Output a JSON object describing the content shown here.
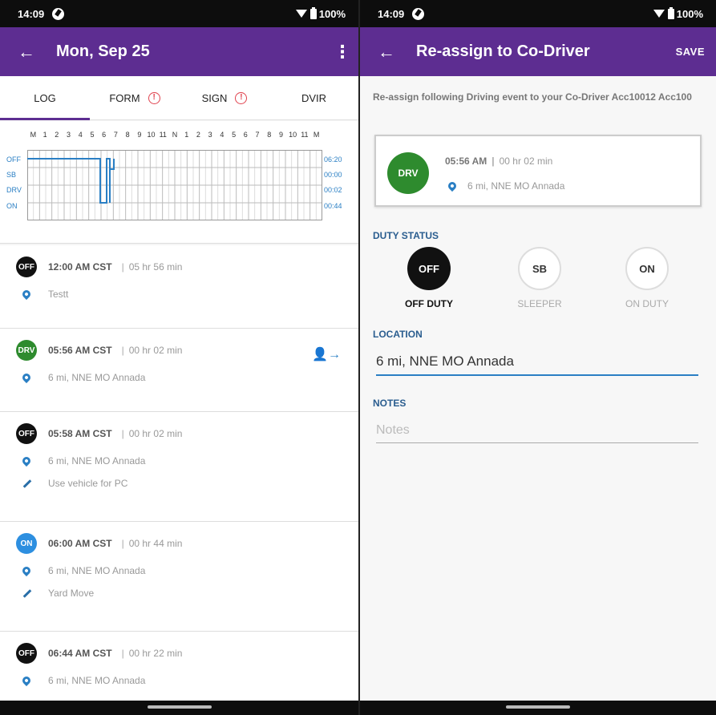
{
  "status_bar": {
    "time": "14:09",
    "battery": "100%"
  },
  "left": {
    "title": "Mon, Sep 25",
    "tabs": [
      {
        "label": "LOG",
        "warning": false
      },
      {
        "label": "FORM",
        "warning": true
      },
      {
        "label": "SIGN",
        "warning": true
      },
      {
        "label": "DVIR",
        "warning": false
      }
    ],
    "graph": {
      "hours": [
        "M",
        "1",
        "2",
        "3",
        "4",
        "5",
        "6",
        "7",
        "8",
        "9",
        "10",
        "11",
        "N",
        "1",
        "2",
        "3",
        "4",
        "5",
        "6",
        "7",
        "8",
        "9",
        "10",
        "11",
        "M"
      ],
      "rows": [
        {
          "label": "OFF",
          "total": "06:20"
        },
        {
          "label": "SB",
          "total": "00:00"
        },
        {
          "label": "DRV",
          "total": "00:02"
        },
        {
          "label": "ON",
          "total": "00:44"
        }
      ]
    },
    "entries": [
      {
        "badge": "OFF",
        "time": "12:00 AM CST",
        "duration": "05 hr 56 min",
        "location": "Testt",
        "note": ""
      },
      {
        "badge": "DRV",
        "time": "05:56 AM CST",
        "duration": "00 hr 02 min",
        "location": "6 mi, NNE MO Annada",
        "note": ""
      },
      {
        "badge": "OFF",
        "time": "05:58 AM CST",
        "duration": "00 hr 02 min",
        "location": "6 mi, NNE MO Annada",
        "note": "Use vehicle for PC"
      },
      {
        "badge": "ON",
        "time": "06:00 AM CST",
        "duration": "00 hr 44 min",
        "location": "6 mi, NNE MO Annada",
        "note": "Yard Move"
      },
      {
        "badge": "OFF",
        "time": "06:44 AM CST",
        "duration": "00 hr 22 min",
        "location": "6 mi, NNE MO Annada",
        "note": ""
      }
    ]
  },
  "right": {
    "title": "Re-assign to Co-Driver",
    "save_label": "SAVE",
    "intro": "Re-assign following Driving event to your Co-Driver Acc10012 Acc100",
    "event": {
      "badge": "DRV",
      "time": "05:56 AM",
      "duration": "00 hr 02 min",
      "location": "6 mi, NNE MO Annada"
    },
    "duty_status_label": "DUTY STATUS",
    "duty_options": [
      {
        "code": "OFF",
        "label": "OFF DUTY",
        "selected": true
      },
      {
        "code": "SB",
        "label": "SLEEPER",
        "selected": false
      },
      {
        "code": "ON",
        "label": "ON DUTY",
        "selected": false
      }
    ],
    "location_label": "LOCATION",
    "location_value": "6 mi, NNE MO Annada",
    "notes_label": "NOTES",
    "notes_placeholder": "Notes"
  },
  "colors": {
    "brand": "#5d2d91",
    "drv": "#2e8b2e",
    "on": "#2d8fe0",
    "accent": "#2a7fc4"
  }
}
